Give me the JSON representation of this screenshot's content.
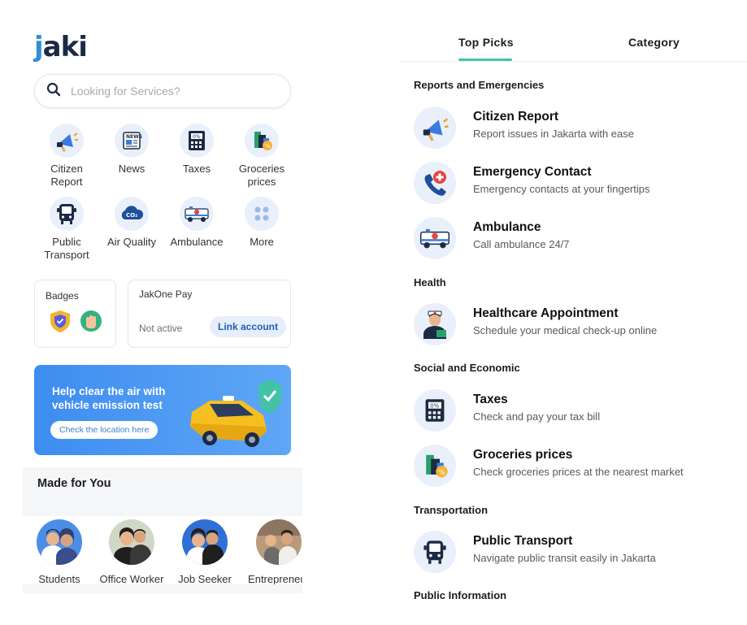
{
  "left": {
    "logo": {
      "prefix": "j",
      "text": "aki"
    },
    "search": {
      "placeholder": "Looking for Services?"
    },
    "services": [
      {
        "label": "Citizen Report",
        "icon": "megaphone-icon"
      },
      {
        "label": "News",
        "icon": "newspaper-icon"
      },
      {
        "label": "Taxes",
        "icon": "calculator-icon"
      },
      {
        "label": "Groceries prices",
        "icon": "groceries-icon"
      },
      {
        "label": "Public Transport",
        "icon": "bus-icon"
      },
      {
        "label": "Air Quality",
        "icon": "co2-cloud-icon"
      },
      {
        "label": "Ambulance",
        "icon": "ambulance-icon"
      },
      {
        "label": "More",
        "icon": "grid-dots-icon"
      }
    ],
    "badges": {
      "title": "Badges"
    },
    "jakone": {
      "title": "JakOne Pay",
      "status": "Not active",
      "link_label": "Link account"
    },
    "banner": {
      "text": "Help clear the air with vehicle emission test",
      "cta": "Check the location here"
    },
    "made_for_you": {
      "title": "Made for You",
      "personas": [
        "Students",
        "Office Worker",
        "Job Seeker",
        "Entrepreneur"
      ]
    }
  },
  "right": {
    "tabs": [
      "Top Picks",
      "Category"
    ],
    "active_tab": "Top Picks",
    "sections": [
      {
        "title": "Reports and Emergencies",
        "items": [
          {
            "name": "Citizen Report",
            "desc": "Report issues in Jakarta with ease",
            "icon": "megaphone-icon"
          },
          {
            "name": "Emergency Contact",
            "desc": "Emergency contacts at your fingertips",
            "icon": "phone-emergency-icon"
          },
          {
            "name": "Ambulance",
            "desc": "Call ambulance 24/7",
            "icon": "ambulance-icon"
          }
        ]
      },
      {
        "title": "Health",
        "items": [
          {
            "name": "Healthcare Appointment",
            "desc": "Schedule your medical check-up online",
            "icon": "nurse-icon"
          }
        ]
      },
      {
        "title": "Social and Economic",
        "items": [
          {
            "name": "Taxes",
            "desc": "Check and pay your tax bill",
            "icon": "calculator-icon"
          },
          {
            "name": "Groceries prices",
            "desc": "Check groceries prices at the nearest market",
            "icon": "groceries-icon"
          }
        ]
      },
      {
        "title": "Transportation",
        "items": [
          {
            "name": "Public Transport",
            "desc": "Navigate public transit easily in Jakarta",
            "icon": "bus-icon"
          }
        ]
      },
      {
        "title": "Public Information",
        "items": []
      }
    ]
  },
  "colors": {
    "accent": "#44c2a8",
    "brand_blue": "#1e5fb4",
    "icon_bg": "#e9f0fb",
    "banner_blue": "#3d8df0"
  }
}
